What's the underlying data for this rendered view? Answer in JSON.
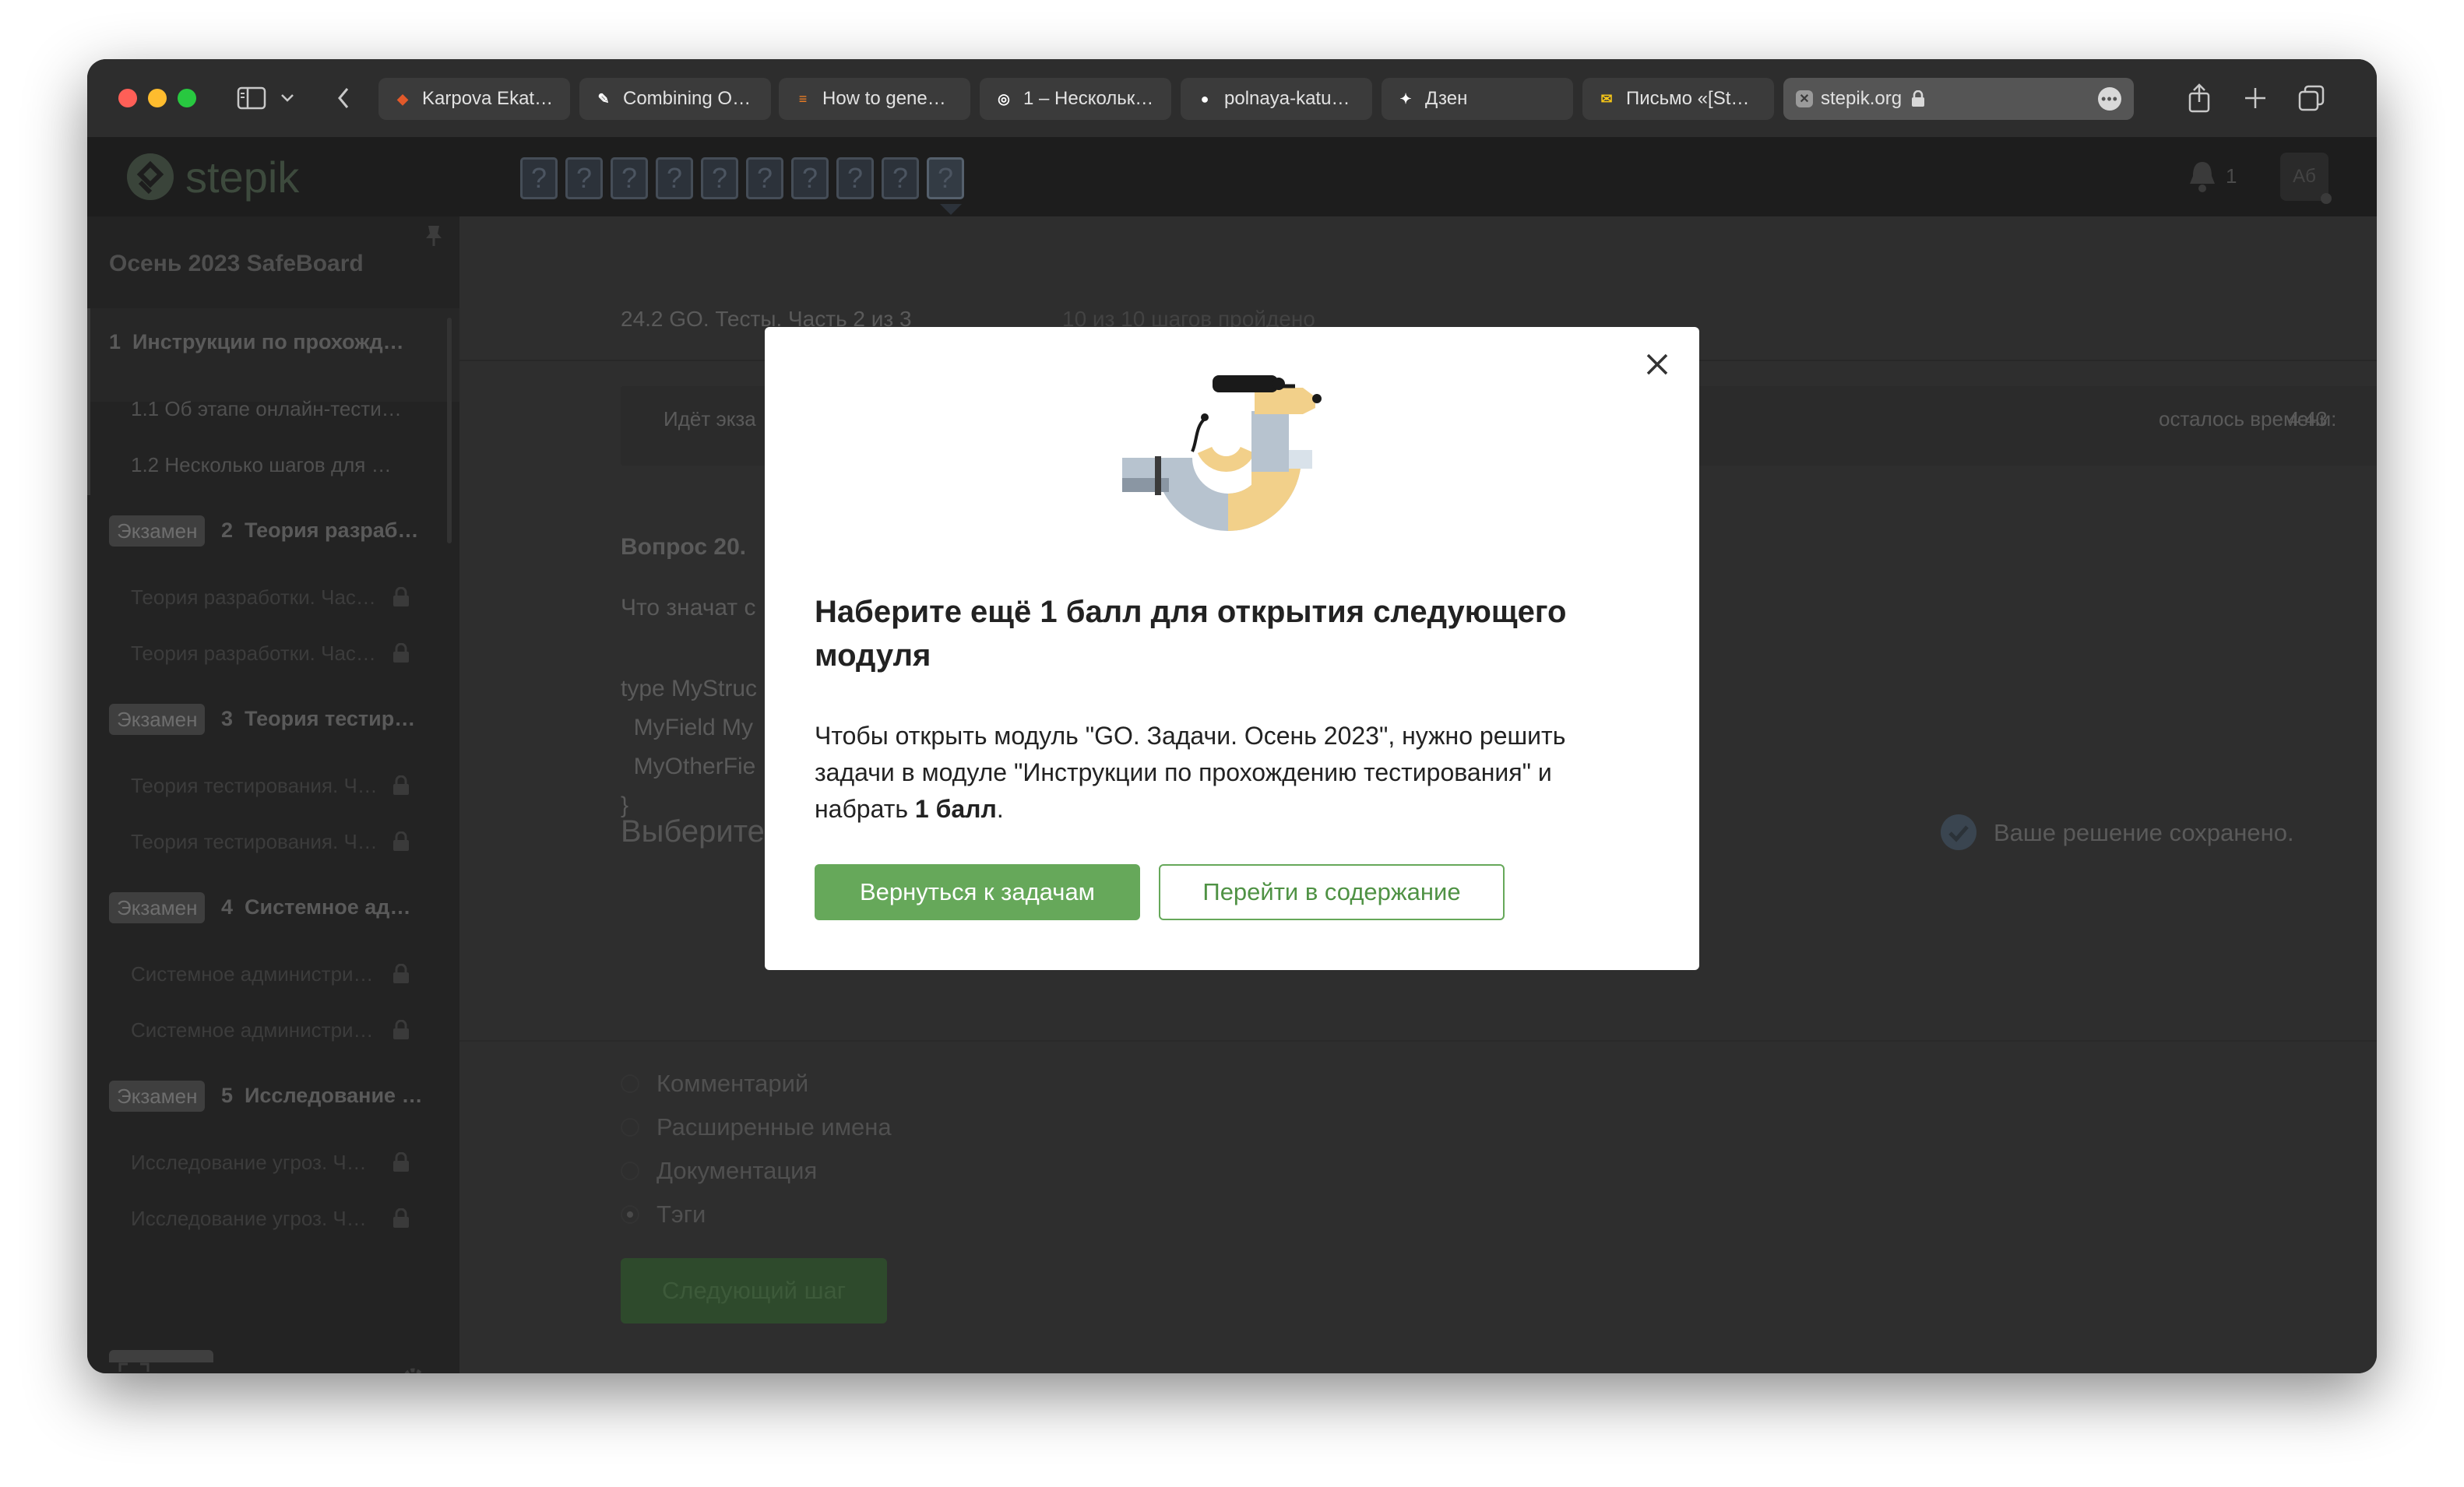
{
  "browser": {
    "tabs": [
      {
        "title": "Karpova Ekat…",
        "icon": "gitlab-icon",
        "color": "#e2592a"
      },
      {
        "title": "Combining O…",
        "icon": "pencil-icon",
        "color": "#ffffff"
      },
      {
        "title": "How to gene…",
        "icon": "stackoverflow-icon",
        "color": "#f48024"
      },
      {
        "title": "1 – Нескольк…",
        "icon": "stepik-icon",
        "color": "#ffffff"
      },
      {
        "title": "polnaya-katu…",
        "icon": "github-icon",
        "color": "#ffffff"
      },
      {
        "title": "Дзен",
        "icon": "dzen-icon",
        "color": "#ffffff"
      },
      {
        "title": "Письмо «[St…",
        "icon": "mail-icon",
        "color": "#f5c518"
      },
      {
        "title": "stepik.org",
        "icon": "site-icon",
        "color": "#ffffff",
        "active": true
      }
    ]
  },
  "header": {
    "logo_text": "stepik",
    "step_marks": [
      "?",
      "?",
      "?",
      "?",
      "?",
      "?",
      "?",
      "?",
      "?",
      "?"
    ],
    "notification_count": "1",
    "avatar_initials": "Аб"
  },
  "sidebar": {
    "course_title": "Осень 2023 SafeBoard",
    "modules": [
      {
        "badge": "",
        "number": "1",
        "title": "Инструкции по прохожд…",
        "lessons": [
          {
            "label": "1.1  Об этапе онлайн-тести…"
          },
          {
            "label": "1.2  Несколько шагов для …"
          }
        ]
      },
      {
        "badge": "Экзамен",
        "number": "2",
        "title": "Теория разраб…",
        "lessons": [
          {
            "label": "Теория разработки. Час…"
          },
          {
            "label": "Теория разработки. Час…"
          }
        ]
      },
      {
        "badge": "Экзамен",
        "number": "3",
        "title": "Теория тестир…",
        "lessons": [
          {
            "label": "Теория тестирования. Ч…"
          },
          {
            "label": "Теория тестирования. Ч…"
          }
        ]
      },
      {
        "badge": "Экзамен",
        "number": "4",
        "title": "Системное ад…",
        "lessons": [
          {
            "label": "Системное администри…"
          },
          {
            "label": "Системное администри…"
          }
        ]
      },
      {
        "badge": "Экзамен",
        "number": "5",
        "title": "Исследование …",
        "lessons": [
          {
            "label": "Исследование угроз. Ч…"
          },
          {
            "label": "Исследование угроз. Ч…"
          }
        ]
      }
    ]
  },
  "main": {
    "lesson_title": "24.2 GO. Тесты. Часть 2 из 3",
    "progress_text": "10 из 10 шагов пройдено",
    "exam_status": "Идёт экза",
    "time_left_label": "осталось времени:",
    "time_left_value": "4:43",
    "question_title": "Вопрос 20.",
    "question_text": "Что значат с",
    "code_lines": [
      "type MyStruc",
      "  MyField My",
      "  MyOtherFie",
      "}"
    ],
    "choose_heading": "Выберите",
    "saved_text": "Ваше решение сохранено.",
    "options": [
      {
        "label": "Комментарий",
        "selected": false
      },
      {
        "label": "Расширенные имена",
        "selected": false
      },
      {
        "label": "Документация",
        "selected": false
      },
      {
        "label": "Тэги",
        "selected": true
      }
    ],
    "next_button": "Следующий шаг"
  },
  "modal": {
    "title": "Наберите ещё 1 балл для открытия следующего модуля",
    "body_part1": "Чтобы открыть модуль \"GO. Задачи. Осень 2023\", нужно решить задачи в модуле \"Инструкции по прохождению тестирования\" и набрать ",
    "body_bold": "1 балл",
    "body_end": ".",
    "primary_button": "Вернуться к задачам",
    "secondary_button": "Перейти в содержание",
    "close_icon": "close-icon",
    "illustration": "dog-illustration"
  },
  "colors": {
    "accent_green": "#66a85a",
    "modal_text": "#222222",
    "stepik_logo": "#3d4a3d"
  }
}
